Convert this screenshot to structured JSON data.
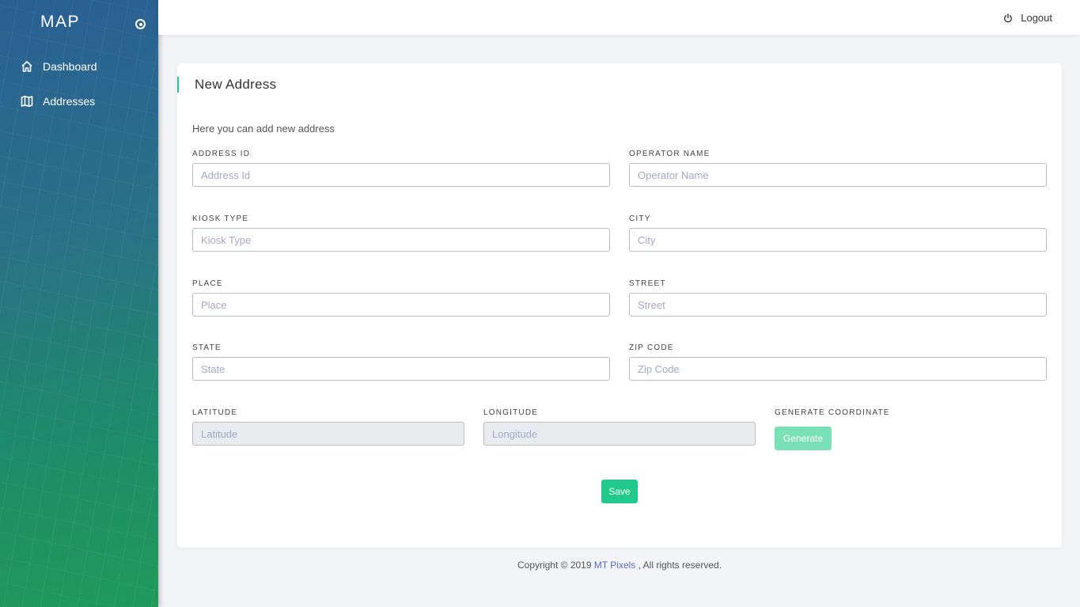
{
  "sidebar": {
    "brand": "MAP",
    "items": [
      {
        "label": "Dashboard",
        "icon": "home-icon"
      },
      {
        "label": "Addresses",
        "icon": "map-icon"
      }
    ]
  },
  "topbar": {
    "logout_label": "Logout"
  },
  "card": {
    "title": "New Address",
    "description": "Here you can add new address",
    "fields": {
      "address_id": {
        "label": "ADDRESS ID",
        "placeholder": "Address Id",
        "value": ""
      },
      "operator_name": {
        "label": "OPERATOR NAME",
        "placeholder": "Operator Name",
        "value": ""
      },
      "kiosk_type": {
        "label": "KIOSK TYPE",
        "placeholder": "Kiosk Type",
        "value": ""
      },
      "city": {
        "label": "CITY",
        "placeholder": "City",
        "value": ""
      },
      "place": {
        "label": "PLACE",
        "placeholder": "Place",
        "value": ""
      },
      "street": {
        "label": "STREET",
        "placeholder": "Street",
        "value": ""
      },
      "state": {
        "label": "STATE",
        "placeholder": "State",
        "value": ""
      },
      "zip_code": {
        "label": "ZIP CODE",
        "placeholder": "Zip Code",
        "value": ""
      },
      "latitude": {
        "label": "LATITUDE",
        "placeholder": "Latitude",
        "value": ""
      },
      "longitude": {
        "label": "LONGITUDE",
        "placeholder": "Longitude",
        "value": ""
      }
    },
    "generate": {
      "label": "GENERATE COORDINATE",
      "button": "Generate"
    },
    "save_label": "Save"
  },
  "footer": {
    "prefix": "Copyright © 2019 ",
    "link": "MT Pixels",
    "suffix": " , All rights reserved."
  },
  "colors": {
    "accent": "#22c98c",
    "generate_button": "#7ae0b8",
    "link": "#5c6ac4"
  }
}
